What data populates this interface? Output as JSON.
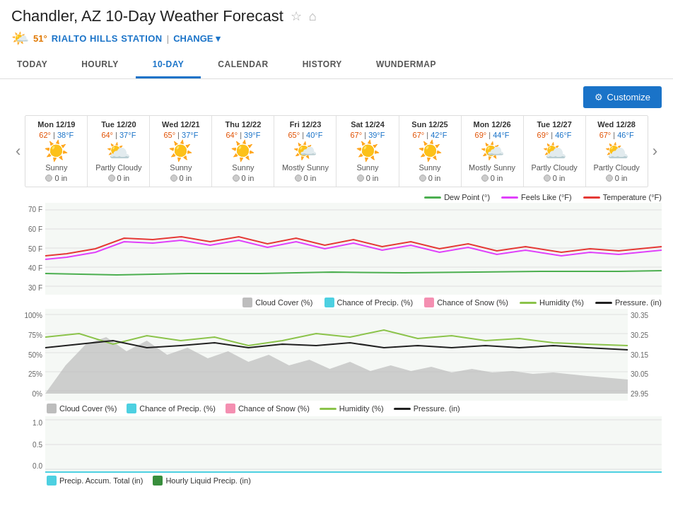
{
  "header": {
    "title": "Chandler, AZ 10-Day Weather Forecast",
    "current_temp": "51°",
    "station": "RIALTO HILLS STATION",
    "change_label": "CHANGE"
  },
  "nav": {
    "tabs": [
      {
        "label": "TODAY",
        "active": false
      },
      {
        "label": "HOURLY",
        "active": false
      },
      {
        "label": "10-DAY",
        "active": true
      },
      {
        "label": "CALENDAR",
        "active": false
      },
      {
        "label": "HISTORY",
        "active": false
      },
      {
        "label": "WUNDERMAP",
        "active": false
      }
    ]
  },
  "toolbar": {
    "customize_label": "Customize"
  },
  "forecast": {
    "days": [
      {
        "date": "Mon 12/19",
        "high": "62°",
        "low": "38°F",
        "icon": "☀️",
        "desc": "Sunny",
        "precip": "0 in"
      },
      {
        "date": "Tue 12/20",
        "high": "64°",
        "low": "37°F",
        "icon": "⛅",
        "desc": "Partly Cloudy",
        "precip": "0 in"
      },
      {
        "date": "Wed 12/21",
        "high": "65°",
        "low": "37°F",
        "icon": "☀️",
        "desc": "Sunny",
        "precip": "0 in"
      },
      {
        "date": "Thu 12/22",
        "high": "64°",
        "low": "39°F",
        "icon": "☀️",
        "desc": "Sunny",
        "precip": "0 in"
      },
      {
        "date": "Fri 12/23",
        "high": "65°",
        "low": "40°F",
        "icon": "🌤️",
        "desc": "Mostly Sunny",
        "precip": "0 in"
      },
      {
        "date": "Sat 12/24",
        "high": "67°",
        "low": "39°F",
        "icon": "☀️",
        "desc": "Sunny",
        "precip": "0 in"
      },
      {
        "date": "Sun 12/25",
        "high": "67°",
        "low": "42°F",
        "icon": "☀️",
        "desc": "Sunny",
        "precip": "0 in"
      },
      {
        "date": "Mon 12/26",
        "high": "69°",
        "low": "44°F",
        "icon": "🌤️",
        "desc": "Mostly Sunny",
        "precip": "0 in"
      },
      {
        "date": "Tue 12/27",
        "high": "69°",
        "low": "46°F",
        "icon": "⛅",
        "desc": "Partly Cloudy",
        "precip": "0 in"
      },
      {
        "date": "Wed 12/28",
        "high": "67°",
        "low": "46°F",
        "icon": "⛅",
        "desc": "Partly Cloudy",
        "precip": "0 in"
      }
    ]
  },
  "temp_chart": {
    "y_labels": [
      "70 F",
      "60 F",
      "50 F",
      "40 F",
      "30 F"
    ],
    "legend": [
      {
        "label": "Dew Point (°)",
        "color": "#4caf50",
        "type": "line"
      },
      {
        "label": "Feels Like (°F)",
        "color": "#e040fb",
        "type": "line"
      },
      {
        "label": "Temperature (°F)",
        "color": "#e53935",
        "type": "line"
      }
    ]
  },
  "precip_chart": {
    "y_labels_left": [
      "100%",
      "75%",
      "50%",
      "25%",
      "0%"
    ],
    "y_labels_right": [
      "30.35",
      "30.25",
      "30.15",
      "30.05",
      "29.95"
    ],
    "legend": [
      {
        "label": "Cloud Cover (%)",
        "color": "#bdbdbd",
        "type": "area"
      },
      {
        "label": "Chance of Precip. (%)",
        "color": "#4dd0e1",
        "type": "area"
      },
      {
        "label": "Chance of Snow (%)",
        "color": "#f48fb1",
        "type": "area"
      },
      {
        "label": "Humidity (%)",
        "color": "#8bc34a",
        "type": "line"
      },
      {
        "label": "Pressure. (in)",
        "color": "#212121",
        "type": "line"
      }
    ]
  },
  "bottom_chart": {
    "y_labels": [
      "1.0",
      "0.5",
      "0.0"
    ],
    "legend": [
      {
        "label": "Precip. Accum. Total (in)",
        "color": "#4dd0e1",
        "type": "area"
      },
      {
        "label": "Hourly Liquid Precip. (in)",
        "color": "#388e3c",
        "type": "area"
      }
    ]
  },
  "colors": {
    "accent_blue": "#1a73c8",
    "temp_high": "#e05000",
    "temp_low": "#1a73c8",
    "customize_bg": "#1a73c8",
    "dew_point": "#4caf50",
    "feels_like": "#e040fb",
    "temperature": "#e53935",
    "cloud_cover": "#bdbdbd",
    "chance_precip": "#4dd0e1",
    "chance_snow": "#f48fb1",
    "humidity": "#8bc34a",
    "pressure": "#212121"
  }
}
